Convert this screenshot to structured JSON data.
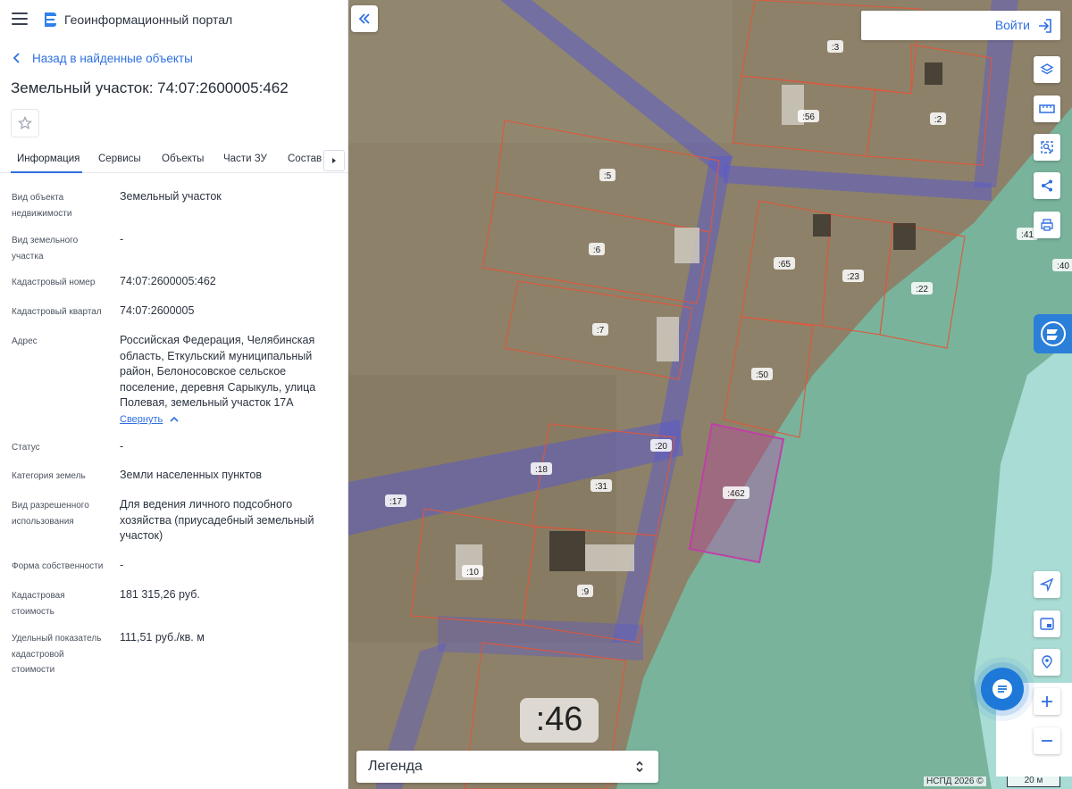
{
  "header": {
    "portal_title": "Геоинформационный портал",
    "back_label": "Назад в найденные объекты",
    "object_title": "Земельный участок: 74:07:2600005:462"
  },
  "tabs": [
    "Информация",
    "Сервисы",
    "Объекты",
    "Части ЗУ",
    "Состав"
  ],
  "info": {
    "rows": [
      {
        "label": "Вид объекта недвижимости",
        "value": "Земельный участок"
      },
      {
        "label": "Вид земельного участка",
        "value": "-"
      },
      {
        "label": "Кадастровый номер",
        "value": "74:07:2600005:462"
      },
      {
        "label": "Кадастровый квартал",
        "value": "74:07:2600005"
      },
      {
        "label": "Адрес",
        "value": "Российская Федерация, Челябинская область, Еткульский муниципальный район, Белоносовское сельское поселение, деревня Сарыкуль, улица Полевая, земельный участок 17А"
      },
      {
        "label": "Статус",
        "value": "-"
      },
      {
        "label": "Категория земель",
        "value": "Земли населенных пунктов"
      },
      {
        "label": "Вид разрешенного использования",
        "value": "Для ведения личного подсобного хозяйства (приусадебный земельный участок)"
      },
      {
        "label": "Форма собственности",
        "value": "-"
      },
      {
        "label": "Кадастровая стоимость",
        "value": "181 315,26 руб."
      },
      {
        "label": "Удельный показатель кадастровой стоимости",
        "value": "111,51 руб./кв. м"
      }
    ],
    "collapse_label": "Свернуть"
  },
  "map": {
    "login_label": "Войти",
    "legend_label": "Легенда",
    "copyright": "НСПД 2026 ©",
    "scale_label": "20 м",
    "big_label": ":46",
    "plot_labels": [
      ":3",
      ":56",
      ":2",
      ":5",
      ":6",
      ":7",
      ":65",
      ":23",
      ":22",
      ":41",
      ":40",
      ":50",
      ":20",
      ":18",
      ":31",
      ":17",
      ":462",
      ":10",
      ":9"
    ],
    "selected_plot": ":462",
    "selected_color": "#c03fa8",
    "tools": [
      "layers-icon",
      "ruler-icon",
      "select-area-icon",
      "share-icon",
      "print-icon"
    ],
    "bottom_tools": [
      "locate-icon",
      "minimap-icon",
      "geo-pin-icon",
      "zoom-in-icon",
      "zoom-out-icon"
    ]
  }
}
